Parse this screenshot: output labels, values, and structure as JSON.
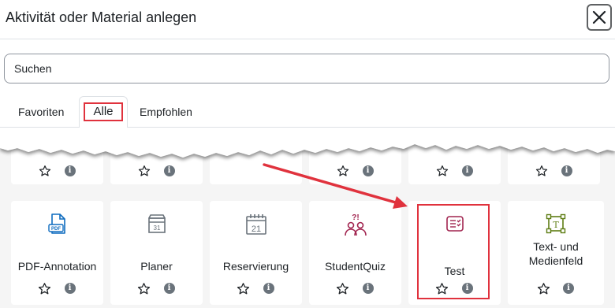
{
  "dialog": {
    "title": "Aktivität oder Material anlegen"
  },
  "search": {
    "placeholder": "Suchen"
  },
  "tabs": [
    {
      "label": "Favoriten"
    },
    {
      "label": "Alle"
    },
    {
      "label": "Empfohlen"
    }
  ],
  "top_row": [
    {
      "icons": [
        "star-icon",
        "info-icon"
      ]
    },
    {
      "icons": [
        "star-icon",
        "info-icon"
      ]
    },
    {
      "icons": [
        "star-icon",
        "info-icon"
      ]
    },
    {
      "icons": [
        "star-icon",
        "info-icon"
      ]
    },
    {
      "icons": [
        "star-icon",
        "info-icon"
      ]
    },
    {
      "icons": [
        "star-icon",
        "info-icon"
      ]
    }
  ],
  "activities": [
    {
      "label": "PDF-Annotation",
      "icon": "pdf-file-icon",
      "color": "#0f6cbf"
    },
    {
      "label": "Planer",
      "icon": "calendar-planner-icon",
      "color": "#6a737b"
    },
    {
      "label": "Reservierung",
      "icon": "calendar-reservation-icon",
      "color": "#6a737b"
    },
    {
      "label": "StudentQuiz",
      "icon": "student-quiz-icon",
      "color": "#a1244f"
    },
    {
      "label": "Test",
      "icon": "test-icon",
      "color": "#a1244f"
    },
    {
      "label": "Text- und Medienfeld",
      "icon": "text-media-icon",
      "color": "#5e7d13"
    }
  ],
  "info_glyph": "i",
  "colors": {
    "highlight": "#e0323d",
    "accent": "#0f6cbf"
  }
}
